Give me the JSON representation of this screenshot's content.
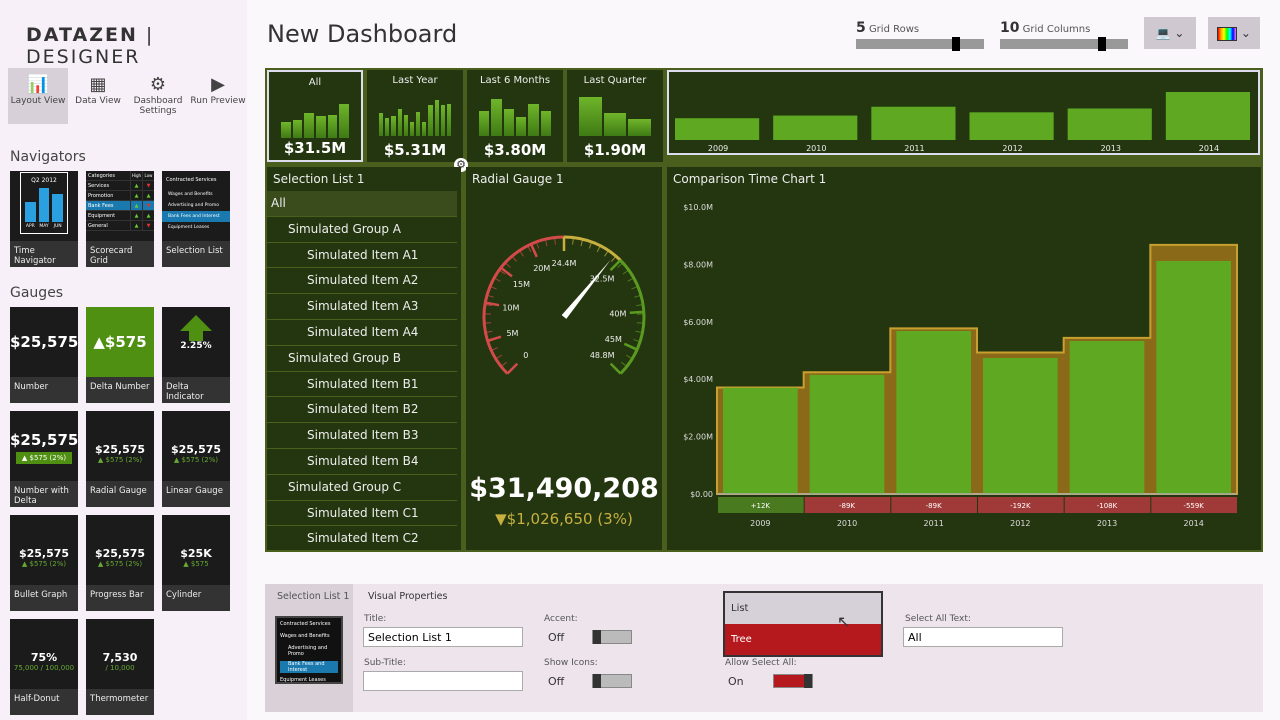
{
  "app": {
    "brand_a": "DATAZEN",
    "brand_b": "DESIGNER",
    "page_title": "New Dashboard"
  },
  "toolbar": [
    {
      "label": "Layout View",
      "icon": "layout-view-icon"
    },
    {
      "label": "Data View",
      "icon": "data-view-icon"
    },
    {
      "label": "Dashboard Settings",
      "icon": "dashboard-settings-icon"
    },
    {
      "label": "Run Preview",
      "icon": "play-icon"
    }
  ],
  "sections": {
    "navigators": "Navigators",
    "gauges": "Gauges"
  },
  "navigators": [
    {
      "label": "Time Navigator",
      "preview": "Q2 2012",
      "months": [
        "APR",
        "MAY",
        "JUN"
      ]
    },
    {
      "label": "Scorecard Grid",
      "headers": [
        "Categories",
        "High",
        "Low"
      ],
      "rows": [
        "Services",
        "Promotion",
        "Bank Fees",
        "Equipment",
        "General"
      ]
    },
    {
      "label": "Selection List",
      "preview": "Contracted Services",
      "items": [
        "Wages and Benefits",
        "Advertising and Promo",
        "Bank Fees and Interest",
        "Equipment Leases"
      ]
    }
  ],
  "gauges": [
    {
      "label": "Number",
      "value": "$25,575"
    },
    {
      "label": "Delta Number",
      "value": "▲$575"
    },
    {
      "label": "Delta Indicator",
      "value": "2.25%"
    },
    {
      "label": "Number with Delta",
      "value": "$25,575",
      "delta": "▲ $575 (2%)"
    },
    {
      "label": "Radial Gauge",
      "value": "$25,575",
      "delta": "▲ $575 (2%)"
    },
    {
      "label": "Linear Gauge",
      "value": "$25,575",
      "delta": "▲ $575 (2%)"
    },
    {
      "label": "Bullet Graph",
      "value": "$25,575",
      "delta": "▲ $575 (2%)"
    },
    {
      "label": "Progress Bar",
      "value": "$25,575",
      "delta": "▲ $575 (2%)"
    },
    {
      "label": "Cylinder",
      "value": "$25K",
      "delta": "▲ $575"
    },
    {
      "label": "Half-Donut",
      "value": "75%",
      "delta": "75,000 / 100,000"
    },
    {
      "label": "Thermometer",
      "value": "7,530",
      "delta": "/ 10,000"
    }
  ],
  "grid": {
    "rows": 5,
    "rows_label": "Grid Rows",
    "cols": 10,
    "cols_label": "Grid Columns"
  },
  "time_nav": {
    "tiles": [
      {
        "label": "All",
        "value": "$31.5M",
        "selected": true,
        "bars": [
          35,
          40,
          55,
          48,
          50,
          75
        ]
      },
      {
        "label": "Last Year",
        "value": "$5.31M",
        "bars": [
          50,
          40,
          44,
          58,
          45,
          30,
          52,
          30,
          68,
          78,
          68,
          70
        ]
      },
      {
        "label": "Last 6 Months",
        "value": "$3.80M",
        "bars": [
          55,
          80,
          58,
          42,
          70,
          55
        ]
      },
      {
        "label": "Last Quarter",
        "value": "$1.90M",
        "bars": [
          85,
          50,
          38
        ]
      }
    ],
    "years": [
      "2009",
      "2010",
      "2011",
      "2012",
      "2013",
      "2014"
    ],
    "year_bars": [
      3.7,
      4.15,
      5.65,
      4.7,
      5.35,
      8.15
    ]
  },
  "selection_list": {
    "title": "Selection List 1",
    "items": [
      {
        "t": "All",
        "lvl": 0,
        "sel": true
      },
      {
        "t": "Simulated Group A",
        "lvl": 1
      },
      {
        "t": "Simulated Item A1",
        "lvl": 2
      },
      {
        "t": "Simulated Item A2",
        "lvl": 2
      },
      {
        "t": "Simulated Item A3",
        "lvl": 2
      },
      {
        "t": "Simulated Item A4",
        "lvl": 2
      },
      {
        "t": "Simulated Group B",
        "lvl": 1
      },
      {
        "t": "Simulated Item B1",
        "lvl": 2
      },
      {
        "t": "Simulated Item B2",
        "lvl": 2
      },
      {
        "t": "Simulated Item B3",
        "lvl": 2
      },
      {
        "t": "Simulated Item B4",
        "lvl": 2
      },
      {
        "t": "Simulated Group C",
        "lvl": 1
      },
      {
        "t": "Simulated Item C1",
        "lvl": 2
      },
      {
        "t": "Simulated Item C2",
        "lvl": 2
      }
    ]
  },
  "radial_gauge": {
    "title": "Radial Gauge 1",
    "value": "$31,490,208",
    "delta": "▼$1,026,650 (3%)",
    "min": 0,
    "max": 48.8,
    "needle": 31.49,
    "ticks": [
      "0",
      "5M",
      "10M",
      "15M",
      "20M",
      "24.4M",
      "32.5M",
      "40M",
      "45M",
      "48.8M"
    ],
    "tick_values": [
      0,
      5,
      10,
      15,
      20,
      24.4,
      32.5,
      40,
      45,
      48.8
    ],
    "colors": {
      "low": "#d24a4a",
      "mid": "#c8b040",
      "high": "#5a9a20"
    }
  },
  "chart_data": {
    "type": "bar",
    "title": "Comparison Time Chart 1",
    "categories": [
      "2009",
      "2010",
      "2011",
      "2012",
      "2013",
      "2014"
    ],
    "series": [
      {
        "values": [
          3.7,
          4.15,
          5.68,
          4.74,
          5.33,
          8.12
        ]
      },
      {
        "values": [
          3.71,
          4.24,
          5.77,
          4.93,
          5.44,
          8.68
        ]
      }
    ],
    "deltas": [
      "+12K",
      "-89K",
      "-89K",
      "-192K",
      "-108K",
      "-559K"
    ],
    "yticks": [
      "$0.00",
      "$2.00M",
      "$4.00M",
      "$6.00M",
      "$8.00M",
      "$10.0M"
    ],
    "ylim": [
      0,
      10
    ],
    "colors": {
      "actual": "#5ea822",
      "target": "#8a6a18",
      "pos": "#4a7a20",
      "neg": "#a03a38"
    }
  },
  "props": {
    "tab_left": "Selection List 1",
    "tab": "Visual Properties",
    "title_label": "Title:",
    "title_value": "Selection List 1",
    "subtitle_label": "Sub-Title:",
    "subtitle_value": "",
    "accent_label": "Accent:",
    "accent_state": "Off",
    "icons_label": "Show Icons:",
    "icons_state": "Off",
    "mode_options": [
      "List",
      "Tree"
    ],
    "mode_selected": "Tree",
    "allow_all_label": "Allow Select All:",
    "allow_all_state": "On",
    "select_all_label": "Select All Text:",
    "select_all_value": "All"
  }
}
